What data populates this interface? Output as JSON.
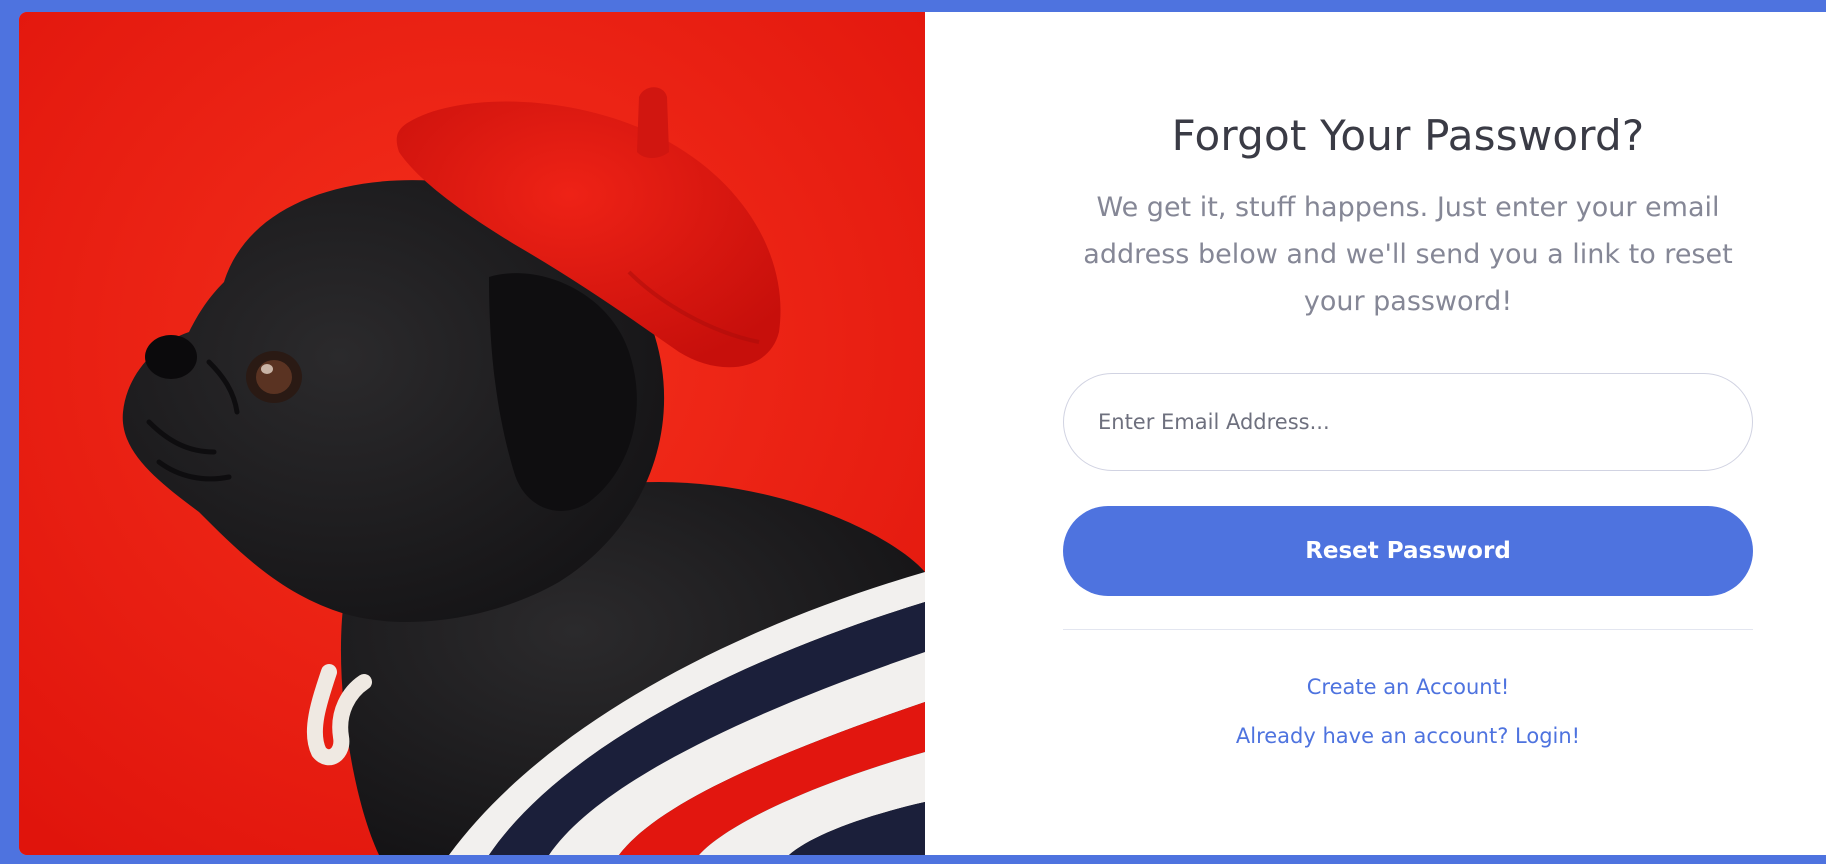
{
  "page": {
    "title": "Forgot Your Password?",
    "subtitle": "We get it, stuff happens. Just enter your email address below and we'll send you a link to reset your password!"
  },
  "form": {
    "email_placeholder": "Enter Email Address...",
    "email_value": "",
    "reset_button_label": "Reset Password"
  },
  "links": {
    "create_account": "Create an Account!",
    "login": "Already have an account? Login!"
  },
  "colors": {
    "primary": "#4e73df",
    "background_red": "#f21d13",
    "beret_red": "#d8140f",
    "dog_black": "#1c1b1d",
    "text_dark": "#3a3b45",
    "text_muted": "#858796"
  }
}
